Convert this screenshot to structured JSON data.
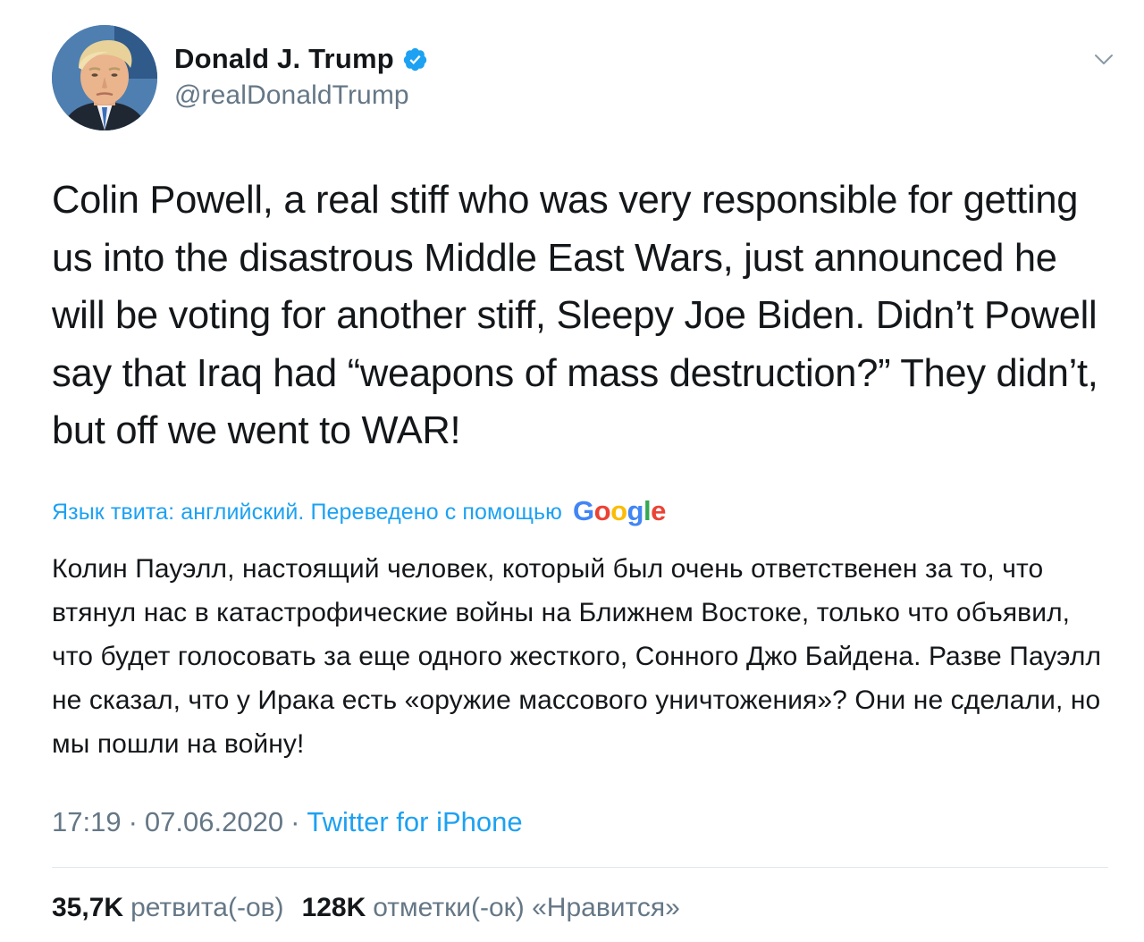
{
  "author": {
    "display_name": "Donald J. Trump",
    "handle": "@realDonaldTrump",
    "verified_icon": "verified-badge-icon",
    "verified_color": "#1da1f2"
  },
  "menu": {
    "icon": "chevron-down-icon"
  },
  "tweet": {
    "text": "Colin Powell, a real stiff who was very responsible for getting us into the disastrous Middle East Wars, just announced he will be voting for another stiff, Sleepy Joe Biden. Didn’t Powell say that Iraq had “weapons of mass destruction?” They didn’t, but off we went to WAR!"
  },
  "translation": {
    "label": "Язык твита: английский. Переведено с помощью",
    "provider": {
      "letters": [
        "G",
        "o",
        "o",
        "g",
        "l",
        "e"
      ],
      "colors": [
        "#4285f4",
        "#ea4335",
        "#fbbc05",
        "#4285f4",
        "#34a853",
        "#ea4335"
      ]
    },
    "text": "Колин Пауэлл, настоящий человек, который был очень ответственен за то, что втянул нас в катастрофические войны на Ближнем Востоке, только что объявил, что будет голосовать за еще одного жесткого, Сонного Джо Байдена. Разве Пауэлл не сказал, что у Ирака есть «оружие массового уничтожения»? Они не сделали, но мы пошли на войну!"
  },
  "meta": {
    "time": "17:19",
    "separator": "·",
    "date": "07.06.2020",
    "source": "Twitter for iPhone"
  },
  "stats": {
    "retweets_count": "35,7K",
    "retweets_label": "ретвита(-ов)",
    "likes_count": "128K",
    "likes_label": "отметки(-ок) «Нравится»"
  },
  "colors": {
    "link_blue": "#1da1f2",
    "secondary_text": "#657786",
    "primary_text": "#14171a",
    "divider": "#e1e8ed"
  }
}
